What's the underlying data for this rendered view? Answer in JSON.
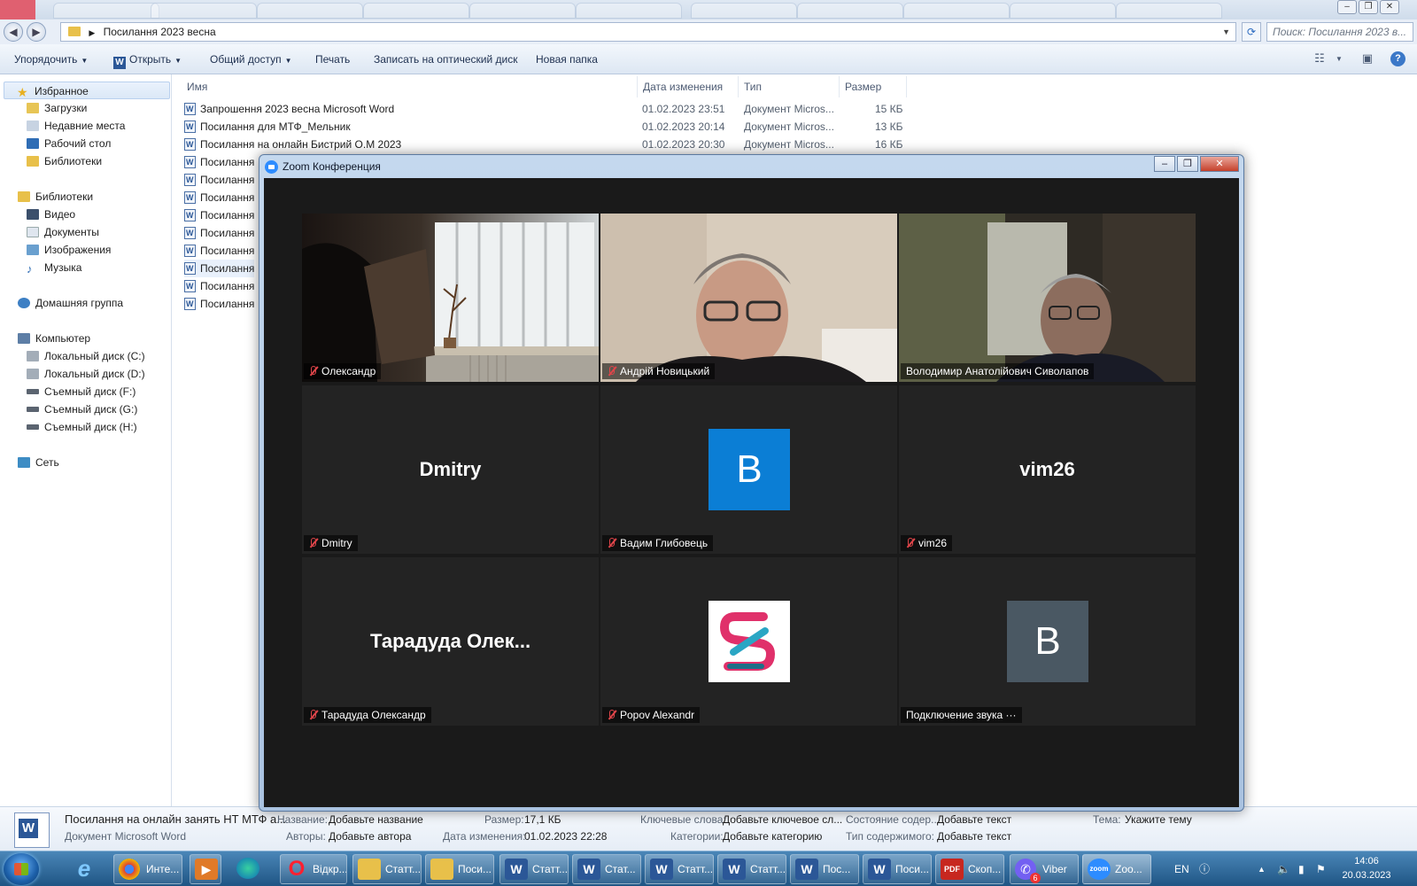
{
  "explorer": {
    "path": "Посилання 2023 весна",
    "search_placeholder": "Поиск: Посилання 2023 в...",
    "toolbar": {
      "organize": "Упорядочить",
      "open": "Открыть",
      "share": "Общий доступ",
      "print": "Печать",
      "burn": "Записать на оптический диск",
      "new_folder": "Новая папка"
    },
    "nav": {
      "favorites": "Избранное",
      "downloads": "Загрузки",
      "recent": "Недавние места",
      "desktop": "Рабочий стол",
      "libraries_fav": "Библиотеки",
      "libraries": "Библиотеки",
      "video": "Видео",
      "documents": "Документы",
      "pictures": "Изображения",
      "music": "Музыка",
      "homegroup": "Домашняя группа",
      "computer": "Компьютер",
      "disk_c": "Локальный диск (C:)",
      "disk_d": "Локальный диск (D:)",
      "disk_f": "Съемный диск (F:)",
      "disk_g": "Съемный диск (G:)",
      "disk_h": "Съемный диск (H:)",
      "network": "Сеть"
    },
    "columns": {
      "name": "Имя",
      "date": "Дата изменения",
      "type": "Тип",
      "size": "Размер"
    },
    "files": [
      {
        "name": "Запрошення 2023 весна Microsoft Word",
        "date": "01.02.2023 23:51",
        "type": "Документ Micros...",
        "size": "15 КБ"
      },
      {
        "name": "Посилання для МТФ_Мельник",
        "date": "01.02.2023 20:14",
        "type": "Документ Micros...",
        "size": "13 КБ"
      },
      {
        "name": "Посилання на онлайн  Бистрий О.М 2023",
        "date": "01.02.2023 20:30",
        "type": "Документ Micros...",
        "size": "16 КБ"
      },
      {
        "name": "Посилання"
      },
      {
        "name": "Посилання"
      },
      {
        "name": "Посилання"
      },
      {
        "name": "Посилання"
      },
      {
        "name": "Посилання"
      },
      {
        "name": "Посилання"
      },
      {
        "name": "Посилання"
      },
      {
        "name": "Посилання"
      },
      {
        "name": "Посилання"
      }
    ],
    "details": {
      "file_name": "Посилання на онлайн занять НТ МТФ а...",
      "file_type": "Документ Microsoft Word",
      "title_label": "Название:",
      "title_value": "Добавьте название",
      "authors_label": "Авторы:",
      "authors_value": "Добавьте автора",
      "size_label": "Размер:",
      "size_value": "17,1 КБ",
      "modified_label": "Дата изменения:",
      "modified_value": "01.02.2023 22:28",
      "keywords_label": "Ключевые слова:",
      "keywords_value": "Добавьте ключевое сл...",
      "categories_label": "Категории:",
      "categories_value": "Добавьте категорию",
      "content_status_label": "Состояние содер...",
      "content_status_value": "Добавьте текст",
      "content_type_label": "Тип содержимого:",
      "content_type_value": "Добавьте текст",
      "subject_label": "Тема:",
      "subject_value": "Укажите тему"
    }
  },
  "zoom": {
    "title": "Zoom Конференция",
    "participants": [
      {
        "label": "Олександр",
        "mode": "video"
      },
      {
        "label": "Андрій Новицький",
        "mode": "video"
      },
      {
        "label": "Володимир Анатолійович Сиволапов",
        "mode": "video",
        "speaking": true
      },
      {
        "label": "Dmitry",
        "big": "Dmitry",
        "mode": "name"
      },
      {
        "label": "Вадим Глибовець",
        "avatar": "В",
        "avatar_color": "#0b7ed5",
        "mode": "avatar"
      },
      {
        "label": "vim26",
        "big": "vim26",
        "mode": "name"
      },
      {
        "label": "Тарадуда Олександр",
        "big": "Тарадуда  Олек...",
        "mode": "name"
      },
      {
        "label": "Popov Alexandr",
        "mode": "logo"
      },
      {
        "label": "Подключение звука ···",
        "avatar": "В",
        "avatar_color": "#4a5863",
        "mode": "avatar"
      }
    ]
  },
  "taskbar": {
    "items": [
      {
        "label": "Инте...",
        "icon": "chrome-icon"
      },
      {
        "label": "Відкр...",
        "icon": "opera-icon"
      },
      {
        "label": "Статт...",
        "icon": "folder-icon"
      },
      {
        "label": "Поси...",
        "icon": "folder-icon"
      },
      {
        "label": "Статт...",
        "icon": "word-icon"
      },
      {
        "label": "Стат...",
        "icon": "word-icon"
      },
      {
        "label": "Статт...",
        "icon": "word-icon"
      },
      {
        "label": "Статт...",
        "icon": "word-icon"
      },
      {
        "label": "Пос...",
        "icon": "word-icon"
      },
      {
        "label": "Поси...",
        "icon": "word-icon"
      },
      {
        "label": "Скоп...",
        "icon": "pdf-icon"
      },
      {
        "label": "Viber",
        "icon": "viber-icon",
        "badge": "6"
      },
      {
        "label": "Zoo...",
        "icon": "zoom-icon"
      }
    ],
    "lang": "EN",
    "time": "14:06",
    "date": "20.03.2023"
  }
}
